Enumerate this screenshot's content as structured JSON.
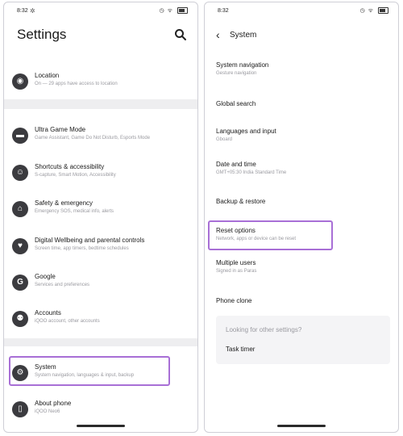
{
  "left": {
    "status": {
      "time": "8:32"
    },
    "title": "Settings",
    "items": [
      {
        "icon": "location-icon",
        "glyph": "◉",
        "title": "Location",
        "subtitle": "On — 29 apps have access to location"
      },
      {
        "icon": "game-controller-icon",
        "glyph": "▬",
        "title": "Ultra Game Mode",
        "subtitle": "Game Assistant, Game Do Not Disturb, Esports Mode"
      },
      {
        "icon": "accessibility-icon",
        "glyph": "☺",
        "title": "Shortcuts & accessibility",
        "subtitle": "S-capture, Smart Motion, Accessibility"
      },
      {
        "icon": "emergency-icon",
        "glyph": "⌂",
        "title": "Safety & emergency",
        "subtitle": "Emergency SOS, medical info, alerts"
      },
      {
        "icon": "digital-wellbeing-icon",
        "glyph": "♥",
        "title": "Digital Wellbeing and parental controls",
        "subtitle": "Screen time, app timers, bedtime schedules"
      },
      {
        "icon": "google-icon",
        "glyph": "G",
        "title": "Google",
        "subtitle": "Services and preferences"
      },
      {
        "icon": "accounts-icon",
        "glyph": "⚉",
        "title": "Accounts",
        "subtitle": "iQOO account, other accounts"
      },
      {
        "icon": "system-gear-icon",
        "glyph": "⚙",
        "title": "System",
        "subtitle": "System navigation, languages & input, backup"
      },
      {
        "icon": "phone-info-icon",
        "glyph": "▯",
        "title": "About phone",
        "subtitle": "iQOO Neo6"
      }
    ]
  },
  "right": {
    "status": {
      "time": "8:32"
    },
    "title": "System",
    "items": [
      {
        "title": "System navigation",
        "subtitle": "Gesture navigation"
      },
      {
        "title": "Global search",
        "subtitle": ""
      },
      {
        "title": "Languages and input",
        "subtitle": "Gboard"
      },
      {
        "title": "Date and time",
        "subtitle": "GMT+05:30 India Standard Time"
      },
      {
        "title": "Backup & restore",
        "subtitle": ""
      },
      {
        "title": "Reset options",
        "subtitle": "Network, apps or device can be reset"
      },
      {
        "title": "Multiple users",
        "subtitle": "Signed in as Paras"
      },
      {
        "title": "Phone clone",
        "subtitle": ""
      }
    ],
    "other_settings_prompt": "Looking for other settings?",
    "task_timer": "Task timer"
  },
  "colors": {
    "highlight": "#a86fd6",
    "section_gap": "#eeeef0",
    "icon_bg": "#3b3b3f"
  }
}
